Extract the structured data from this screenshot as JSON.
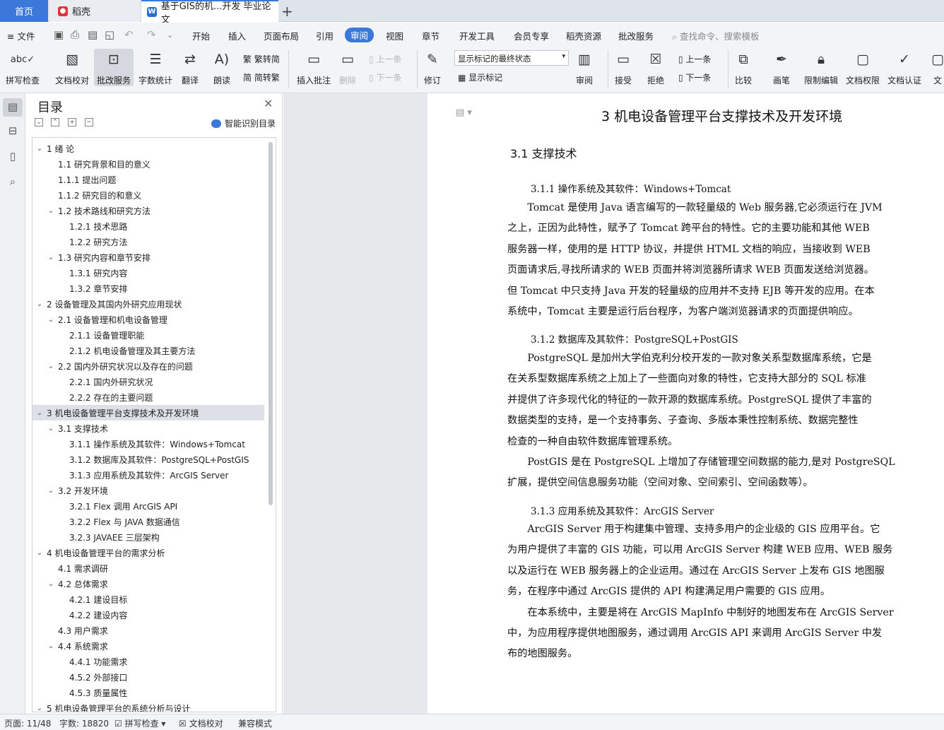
{
  "tabs": {
    "home": "首页",
    "daoke": "稻壳",
    "doc": "基于GIS的机...开发 毕业论文",
    "add": "+"
  },
  "menu": {
    "file": "文件",
    "items": [
      "开始",
      "插入",
      "页面布局",
      "引用",
      "审阅",
      "视图",
      "章节",
      "开发工具",
      "会员专享",
      "稻壳资源",
      "批改服务"
    ],
    "search": "查找命令、搜索模板"
  },
  "ribbon": {
    "spellcheck": "拼写检查",
    "doc_proof": "文档校对",
    "review_service": "批改服务",
    "word_count": "字数统计",
    "translate": "翻译",
    "read_aloud": "朗读",
    "to_traditional": "繁转简",
    "to_simplified": "简转繁",
    "insert_comment": "插入批注",
    "delete": "删除",
    "prev": "上一条",
    "next": "下一条",
    "track": "修订",
    "markup_state": "显示标记的最终状态",
    "show_markup": "显示标记",
    "review": "审阅",
    "accept": "接受",
    "reject": "拒绝",
    "prev2": "上一条",
    "next2": "下一条",
    "compare": "比较",
    "pen": "画笔",
    "restrict_edit": "限制编辑",
    "doc_rights": "文档权限",
    "doc_cert": "文档认证",
    "doc_more": "文"
  },
  "toc": {
    "title": "目录",
    "smart": "智能识别目录",
    "items": [
      {
        "label": "1  绪    论",
        "level": 1,
        "arrow": "v"
      },
      {
        "label": "1.1  研究背景和目的意义",
        "level": 2,
        "arrow": ""
      },
      {
        "label": "1.1.1  提出问题",
        "level": 2,
        "arrow": ""
      },
      {
        "label": "1.1.2  研究目的和意义",
        "level": 2,
        "arrow": ""
      },
      {
        "label": "1.2  技术路线和研究方法",
        "level": 2,
        "arrow": "v"
      },
      {
        "label": "1.2.1  技术思路",
        "level": 3,
        "arrow": ""
      },
      {
        "label": "1.2.2  研究方法",
        "level": 3,
        "arrow": ""
      },
      {
        "label": "1.3  研究内容和章节安排",
        "level": 2,
        "arrow": "v"
      },
      {
        "label": "1.3.1  研究内容",
        "level": 3,
        "arrow": ""
      },
      {
        "label": "1.3.2  章节安排",
        "level": 3,
        "arrow": ""
      },
      {
        "label": "2  设备管理及其国内外研究应用现状",
        "level": 1,
        "arrow": "v"
      },
      {
        "label": "2.1  设备管理和机电设备管理",
        "level": 2,
        "arrow": "v"
      },
      {
        "label": "2.1.1  设备管理职能",
        "level": 3,
        "arrow": ""
      },
      {
        "label": "2.1.2  机电设备管理及其主要方法",
        "level": 3,
        "arrow": ""
      },
      {
        "label": "2.2  国内外研究状况以及存在的问题",
        "level": 2,
        "arrow": "v"
      },
      {
        "label": "2.2.1  国内外研究状况",
        "level": 3,
        "arrow": ""
      },
      {
        "label": "2.2.2  存在的主要问题",
        "level": 3,
        "arrow": ""
      },
      {
        "label": "3  机电设备管理平台支撑技术及开发环境",
        "level": 1,
        "arrow": "v",
        "selected": true
      },
      {
        "label": "3.1  支撑技术",
        "level": 2,
        "arrow": "v"
      },
      {
        "label": "3.1.1  操作系统及其软件：Windows+Tomcat",
        "level": 3,
        "arrow": ""
      },
      {
        "label": "3.1.2  数据库及其软件：PostgreSQL+PostGIS",
        "level": 3,
        "arrow": ""
      },
      {
        "label": "3.1.3  应用系统及其软件：ArcGIS Server",
        "level": 3,
        "arrow": ""
      },
      {
        "label": "3.2  开发环境",
        "level": 2,
        "arrow": "v"
      },
      {
        "label": "3.2.1 Flex 调用 ArcGIS API",
        "level": 3,
        "arrow": ""
      },
      {
        "label": "3.2.2 Flex 与 JAVA 数据通信",
        "level": 3,
        "arrow": ""
      },
      {
        "label": "3.2.3 JAVAEE 三层架构",
        "level": 3,
        "arrow": ""
      },
      {
        "label": "4  机电设备管理平台的需求分析",
        "level": 1,
        "arrow": "v"
      },
      {
        "label": "4.1  需求调研",
        "level": 2,
        "arrow": ""
      },
      {
        "label": "4.2  总体需求",
        "level": 2,
        "arrow": "v"
      },
      {
        "label": "4.2.1  建设目标",
        "level": 3,
        "arrow": ""
      },
      {
        "label": "4.2.2  建设内容",
        "level": 3,
        "arrow": ""
      },
      {
        "label": "4.3  用户需求",
        "level": 2,
        "arrow": ""
      },
      {
        "label": "4.4  系统需求",
        "level": 2,
        "arrow": "v"
      },
      {
        "label": "4.4.1  功能需求",
        "level": 3,
        "arrow": ""
      },
      {
        "label": "4.5.2  外部接口",
        "level": 3,
        "arrow": ""
      },
      {
        "label": "4.5.3  质量属性",
        "level": 3,
        "arrow": ""
      },
      {
        "label": "5  机电设备管理平台的系统分析与设计",
        "level": 1,
        "arrow": "v"
      }
    ]
  },
  "document": {
    "h1": "3  机电设备管理平台支撑技术及开发环境",
    "h2": "3.1  支撑技术",
    "h3_1": "3.1.1  操作系统及其软件：Windows+Tomcat",
    "p1": [
      "　　Tomcat 是使用 Java 语言编写的一款轻量级的 Web 服务器,它必须运行在 JVM",
      "之上，正因为此特性，赋予了 Tomcat 跨平台的特性。它的主要功能和其他 WEB",
      "服务器一样，使用的是 HTTP 协议，并提供 HTML 文档的响应，当接收到 WEB",
      "页面请求后,寻找所请求的 WEB 页面并将浏览器所请求 WEB 页面发送给浏览器。",
      "但 Tomcat 中只支持 Java 开发的轻量级的应用并不支持 EJB 等开发的应用。在本",
      "系统中，Tomcat 主要是运行后台程序，为客户端浏览器请求的页面提供响应。"
    ],
    "h3_2": "3.1.2  数据库及其软件：PostgreSQL+PostGIS",
    "p2": [
      "　　PostgreSQL 是加州大学伯克利分校开发的一款对象关系型数据库系统，它是",
      "在关系型数据库系统之上加上了一些面向对象的特性，它支持大部分的 SQL 标准",
      "并提供了许多现代化的特征的一款开源的数据库系统。PostgreSQL 提供了丰富的",
      "数据类型的支持，是一个支持事务、子查询、多版本秉性控制系统、数据完整性",
      "检查的一种自由软件数据库管理系统。",
      "　　PostGIS 是在 PostgreSQL 上增加了存储管理空间数据的能力,是对 PostgreSQL",
      "扩展，提供空间信息服务功能（空间对象、空间索引、空间函数等）。"
    ],
    "h3_3": "3.1.3  应用系统及其软件：ArcGIS Server",
    "p3": [
      "　　ArcGIS Server 用于构建集中管理、支持多用户的企业级的 GIS 应用平台。它",
      "为用户提供了丰富的 GIS 功能，可以用 ArcGIS Server 构建 WEB 应用、WEB 服务",
      "以及运行在 WEB 服务器上的企业运用。通过在 ArcGIS Server 上发布 GIS 地图服",
      "务，在程序中通过 ArcGIS  提供的 API 构建满足用户需要的 GIS 应用。",
      "　　在本系统中，主要是将在 ArcGIS MapInfo 中制好的地图发布在 ArcGIS Server",
      "中，为应用程序提供地图服务，通过调用 ArcGIS API 来调用 ArcGIS Server 中发",
      "布的地图服务。"
    ]
  },
  "status": {
    "page": "页面: 11/48",
    "words": "字数: 18820",
    "spell": "拼写检查",
    "proof": "文档校对",
    "compat": "兼容模式"
  }
}
